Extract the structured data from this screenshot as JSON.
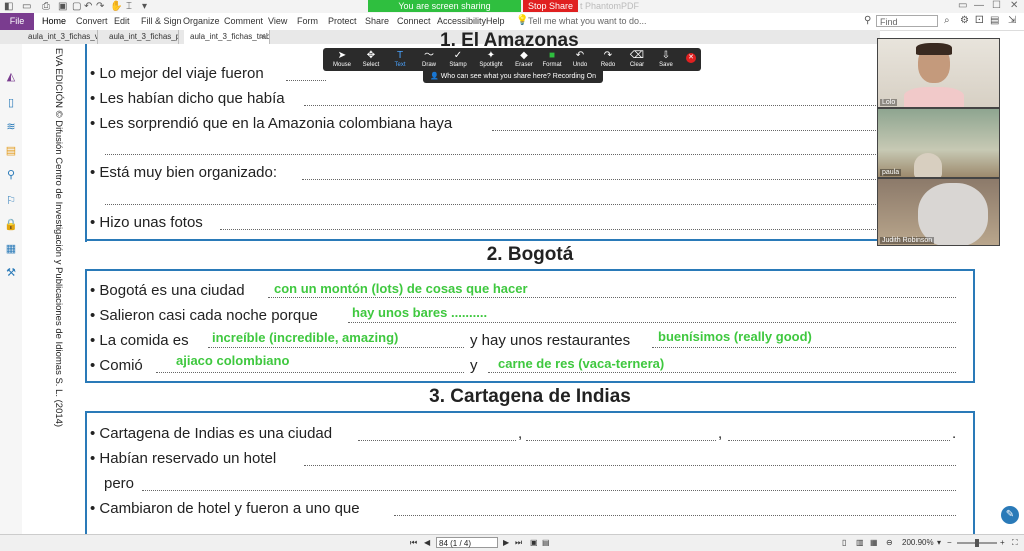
{
  "screen_share": {
    "status_label": "You are screen sharing",
    "stop_label": "Stop Share"
  },
  "app_title_fragment": "t PhantomPDF",
  "ribbon": {
    "file_label": "File",
    "menu": [
      "Home",
      "Convert",
      "Edit",
      "Fill & Sign",
      "Organize",
      "Comment",
      "View",
      "Form",
      "Protect",
      "Share",
      "Connect",
      "Accessibility",
      "Help"
    ],
    "tell_me": "Tell me what you want to do...",
    "find_placeholder": "Find"
  },
  "doc_tabs": [
    "aula_int_3_fichas_vid...",
    "aula_int_3_fichas_pro...",
    "aula_int_3_fichas_traba..."
  ],
  "document": {
    "side_text": "EVA EDICIÓN © Difusión Centro de Investigación y Publicaciones de Idiomas S. L. (2014)",
    "top_title_fragment": "1. El Amazonas",
    "amazonas": [
      "Lo mejor del viaje fueron",
      "Les habían dicho que había",
      "Les sorprendió que en la Amazonia colombiana haya",
      "Está muy bien organizado:",
      "Hizo unas fotos"
    ],
    "bogota": {
      "title": "2. Bogotá",
      "lines": {
        "l1": "Bogotá es una ciudad",
        "l2": "Salieron casi cada noche porque",
        "l3a": "La comida es",
        "l3b": "y hay unos restaurantes",
        "l4a": "Comió",
        "l4b": "y"
      },
      "answers": {
        "a1": "con un montón (lots) de cosas que hacer",
        "a2": "hay unos bares ..........",
        "a3": "increíble (incredible, amazing)",
        "a4": "buenísimos (really good)",
        "a5": "ajiaco colombiano",
        "a6": "carne de res (vaca-ternera)"
      }
    },
    "cartagena": {
      "title": "3. Cartagena de Indias",
      "lines": [
        "Cartagena de Indias es una ciudad",
        "Habían reservado un hotel",
        "pero",
        "Cambiaron de hotel y fueron a uno que"
      ],
      "separators": [
        ",",
        ",",
        "."
      ]
    }
  },
  "zoom_toolbar": {
    "tools": [
      {
        "icon": "mouse-icon",
        "glyph": "➤",
        "label": "Mouse"
      },
      {
        "icon": "select-icon",
        "glyph": "✥",
        "label": "Select"
      },
      {
        "icon": "text-icon",
        "glyph": "T",
        "label": "Text"
      },
      {
        "icon": "draw-icon",
        "glyph": "〜",
        "label": "Draw"
      },
      {
        "icon": "stamp-icon",
        "glyph": "✓",
        "label": "Stamp"
      },
      {
        "icon": "spotlight-icon",
        "glyph": "✦",
        "label": "Spotlight"
      },
      {
        "icon": "eraser-icon",
        "glyph": "◆",
        "label": "Eraser"
      },
      {
        "icon": "format-icon",
        "glyph": "■",
        "label": "Format"
      },
      {
        "icon": "undo-icon",
        "glyph": "↶",
        "label": "Undo"
      },
      {
        "icon": "redo-icon",
        "glyph": "↷",
        "label": "Redo"
      },
      {
        "icon": "clear-icon",
        "glyph": "⌫",
        "label": "Clear"
      },
      {
        "icon": "save-icon",
        "glyph": "⇩",
        "label": "Save"
      }
    ],
    "active_tool": "Text",
    "format_color": "#2fbf3f",
    "recording_notice": "Who can see what you share here? Recording On"
  },
  "participants": [
    "Lolo",
    "paula",
    "Judith Robinson"
  ],
  "status": {
    "page_display": "84 (1 / 4)",
    "zoom": "200.90%"
  },
  "colors": {
    "accent_blue": "#2a7ab8",
    "answer_green": "#3fc83f",
    "file_purple": "#7a3c8f"
  }
}
